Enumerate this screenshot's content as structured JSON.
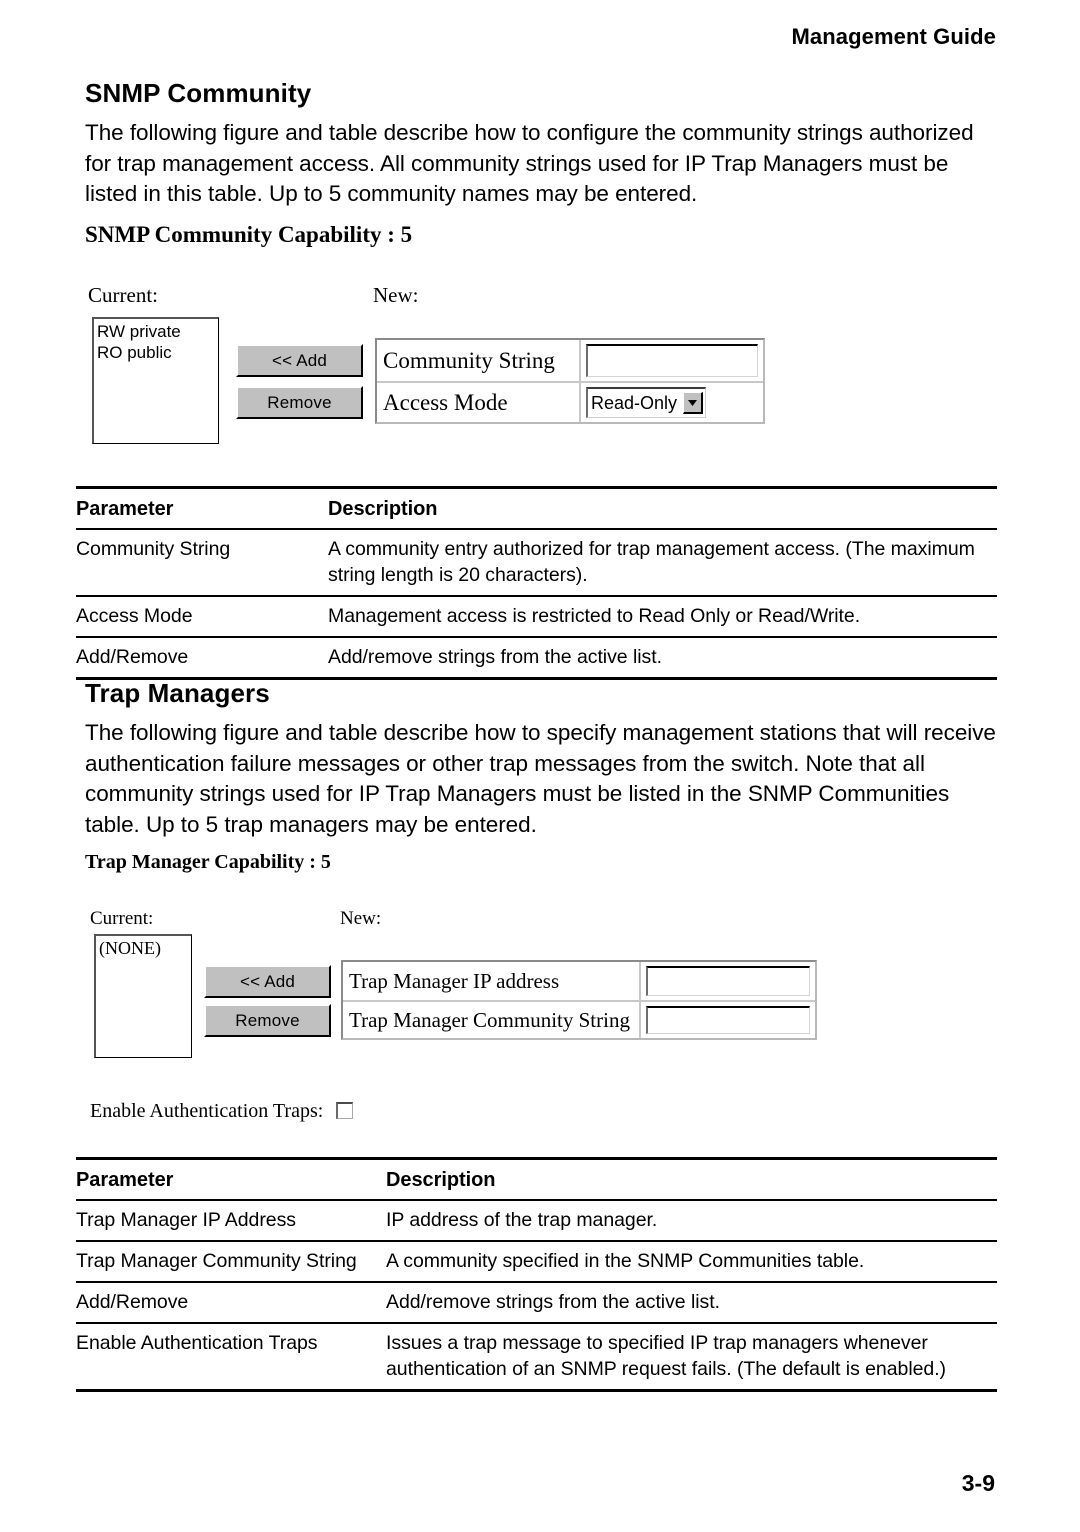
{
  "page": {
    "running_header": "Management Guide",
    "folio": "3-9"
  },
  "section1": {
    "heading": "SNMP Community",
    "paragraph": "The following figure and table describe how to configure the community strings authorized for trap management access. All community strings used for IP Trap Managers must be listed in this table. Up to 5 community names may be entered.",
    "screenshot": {
      "capability_title": "SNMP Community Capability : 5",
      "current_label": "Current:",
      "new_label": "New:",
      "current_list": [
        "RW private",
        "RO public"
      ],
      "add_button": "<< Add",
      "remove_button": "Remove",
      "fields": [
        {
          "label": "Community String",
          "value": "",
          "type": "text"
        },
        {
          "label": "Access Mode",
          "value": "Read-Only",
          "type": "select"
        }
      ]
    },
    "table": {
      "headers": [
        "Parameter",
        "Description"
      ],
      "rows": [
        {
          "parameter": "Community String",
          "description": "A community entry authorized for trap management access. (The maximum string length is 20 characters)."
        },
        {
          "parameter": "Access Mode",
          "description": "Management access is restricted to Read Only or Read/Write."
        },
        {
          "parameter": "Add/Remove",
          "description": "Add/remove strings from the active list."
        }
      ]
    }
  },
  "section2": {
    "heading": "Trap Managers",
    "paragraph": "The following figure and table describe how to specify management stations that will receive authentication failure messages or other trap messages from the switch. Note that all community strings used for IP Trap Managers must be listed in the SNMP Communities table. Up to 5 trap managers may be entered.",
    "screenshot": {
      "capability_title": "Trap Manager Capability : 5",
      "current_label": "Current:",
      "new_label": "New:",
      "current_list": [
        "(NONE)"
      ],
      "add_button": "<< Add",
      "remove_button": "Remove",
      "fields": [
        {
          "label": "Trap Manager IP address",
          "value": "",
          "type": "text"
        },
        {
          "label": "Trap Manager Community String",
          "value": "",
          "type": "text"
        }
      ],
      "checkbox_label": "Enable Authentication Traps:",
      "checkbox_checked": false
    },
    "table": {
      "headers": [
        "Parameter",
        "Description"
      ],
      "rows": [
        {
          "parameter": "Trap Manager IP Address",
          "description": "IP address of the trap manager."
        },
        {
          "parameter": "Trap Manager Community String",
          "description": "A community specified in the SNMP Communities table."
        },
        {
          "parameter": "Add/Remove",
          "description": "Add/remove strings from the active list."
        },
        {
          "parameter": "Enable Authentication Traps",
          "description": "Issues a trap message to specified IP trap managers whenever authentication of an SNMP request fails. (The default is enabled.)"
        }
      ]
    }
  }
}
